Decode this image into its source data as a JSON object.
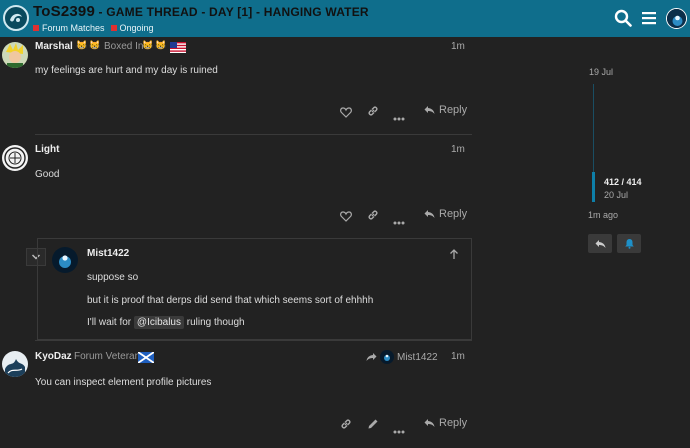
{
  "header": {
    "title_part1": "ToS2399",
    "title_part2": " - GAME THREAD - DAY [1] - HANGING WATER",
    "categories": [
      "Forum Matches",
      "Ongoing"
    ],
    "accent": "#0f6e8c"
  },
  "posts": [
    {
      "username": "Marshal",
      "title": "Boxed In",
      "age": "1m",
      "lines": [
        "my feelings are hurt and my day is ruined"
      ],
      "reply_label": "Reply"
    },
    {
      "username": "Light",
      "age": "1m",
      "lines": [
        "Good"
      ],
      "reply_label": "Reply"
    },
    {
      "username": "KyoDaz",
      "title": "Forum Veteran",
      "age": "1m",
      "reply_to": "Mist1422",
      "lines": [
        "You can inspect element profile pictures"
      ],
      "reply_label": "Reply"
    }
  ],
  "embedded": {
    "username": "Mist1422",
    "line1": "suppose so",
    "line2": "but it is proof that derps did send that which seems sort of ehhhh",
    "line3_pre": "I'll wait for",
    "mention": "@Icibalus",
    "line3_post": "ruling though"
  },
  "timeline": {
    "start_date": "19 Jul",
    "count": "412 / 414",
    "end_date": "20 Jul",
    "ago": "1m ago"
  }
}
